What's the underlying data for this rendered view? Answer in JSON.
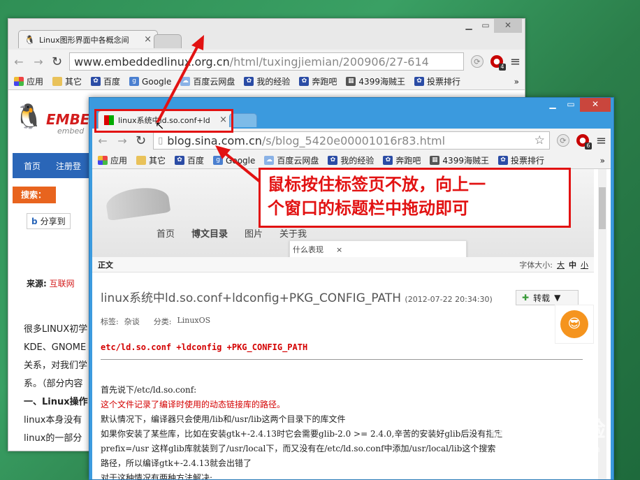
{
  "back_window": {
    "tab_title": "Linux图形界面中各概念间",
    "tab_close": "×",
    "url_main": "www.embeddedlinux.org.cn",
    "url_path": "/html/tuxingjiemian/200906/27-614",
    "ext_badge": "4",
    "bookmarks": [
      "应用",
      "其它",
      "百度",
      "Google",
      "百度云网盘",
      "我的经验",
      "奔跑吧",
      "4399海贼王",
      "投票排行"
    ],
    "bookmarks_more": "»",
    "site": {
      "logo_text": "EMBE",
      "logo_sub": "embed",
      "nav": [
        "首页",
        "注册登"
      ],
      "search_label": "搜索：",
      "share_label": "分享到",
      "source_label": "来源:",
      "source_value": "互联网",
      "paragraphs": [
        "很多LINUX初学",
        "KDE、GNOME",
        "关系，对我们学",
        "系。（部分内容"
      ],
      "heading": "一、Linux操作",
      "p2": [
        "linux本身没有",
        "linux的一部分"
      ]
    }
  },
  "front_window": {
    "tab_title": "linux系统中ld.so.conf+ld",
    "tab_close": "×",
    "url_main": "blog.sina.com.cn",
    "url_path": "/s/blog_5420e00001016r83.html",
    "ext_badge": "6",
    "bookmarks": [
      "应用",
      "其它",
      "百度",
      "Google",
      "百度云网盘",
      "我的经验",
      "奔跑吧",
      "4399海贼王",
      "投票排行"
    ],
    "bookmarks_more": "»",
    "blog": {
      "nav": [
        "首页",
        "博文目录",
        "图片",
        "关于我"
      ],
      "popup_text": "什么表现",
      "popup_close": "×",
      "section_label": "正文",
      "font_size_label": "字体大小:",
      "font_sizes": [
        "大",
        "中",
        "小"
      ],
      "post_title": "linux系统中ld.so.conf+ldconfig+PKG_CONFIG_PATH",
      "post_date": "(2012-07-22 20:34:30)",
      "repost_btn": "转载",
      "tags_label": "标签:",
      "tags_value": "杂谈",
      "category_label": "分类:",
      "category_value": "LinuxOS",
      "red_heading": "etc/ld.so.conf +ldconfig +PKG_CONFIG_PATH",
      "lines": [
        "首先说下/etc/ld.so.conf:",
        "这个文件记录了编译时使用的动态链接库的路径。",
        "默认情况下，编译器只会使用/lib和/usr/lib这两个目录下的库文件",
        "如果你安装了某些库，比如在安装gtk+-2.4.13时它会需要glib-2.0 >= 2.4.0,辛苦的安装好glib后没有指定",
        "prefix=/usr 这样glib库就装到了/usr/local下，而又没有在/etc/ld.so.conf中添加/usr/local/lib这个搜索",
        "路径，所以编译gtk+-2.4.13就会出错了",
        "对于这种情况有两种方法解决:"
      ]
    }
  },
  "callout": {
    "line1": "鼠标按住标签页不放，向上一",
    "line2": "个窗口的标题栏中拖动即可"
  },
  "watermark": {
    "text": "Baidu 经验",
    "url": "jingyan.baidu.com"
  },
  "colors": {
    "annotation_red": "#e21212",
    "front_frame": "#3b9ade",
    "desktop_green": "#2f8f55"
  }
}
